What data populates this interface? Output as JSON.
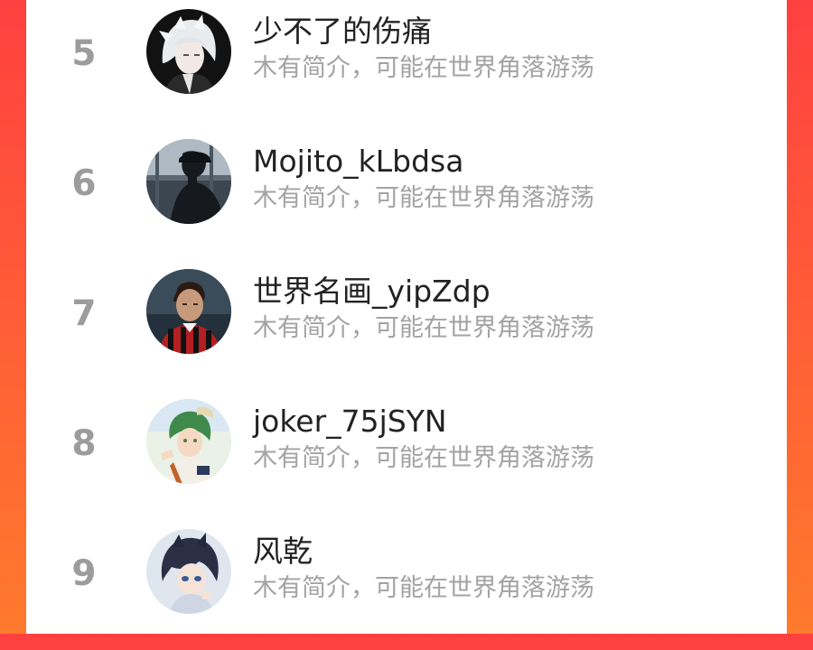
{
  "colors": {
    "background_accent": "#ff4f3a",
    "card": "#ffffff",
    "rank_text": "#9c9c9c",
    "name_text": "#222222",
    "bio_text": "#a3a3a3"
  },
  "ranking": {
    "items": [
      {
        "rank": "5",
        "name": "少不了的伤痛",
        "bio": "木有简介，可能在世界角落游荡",
        "avatar_icon": "avatar-white-hair-anime"
      },
      {
        "rank": "6",
        "name": "Mojito_kLbdsa",
        "bio": "木有简介，可能在世界角落游荡",
        "avatar_icon": "avatar-silhouette-window"
      },
      {
        "rank": "7",
        "name": "世界名画_yipZdp",
        "bio": "木有简介，可能在世界角落游荡",
        "avatar_icon": "avatar-football-player"
      },
      {
        "rank": "8",
        "name": "joker_75jSYN",
        "bio": "木有简介，可能在世界角落游荡",
        "avatar_icon": "avatar-green-hair-anime"
      },
      {
        "rank": "9",
        "name": "风乾",
        "bio": "木有简介，可能在世界角落游荡",
        "avatar_icon": "avatar-dark-hair-anime"
      }
    ]
  }
}
